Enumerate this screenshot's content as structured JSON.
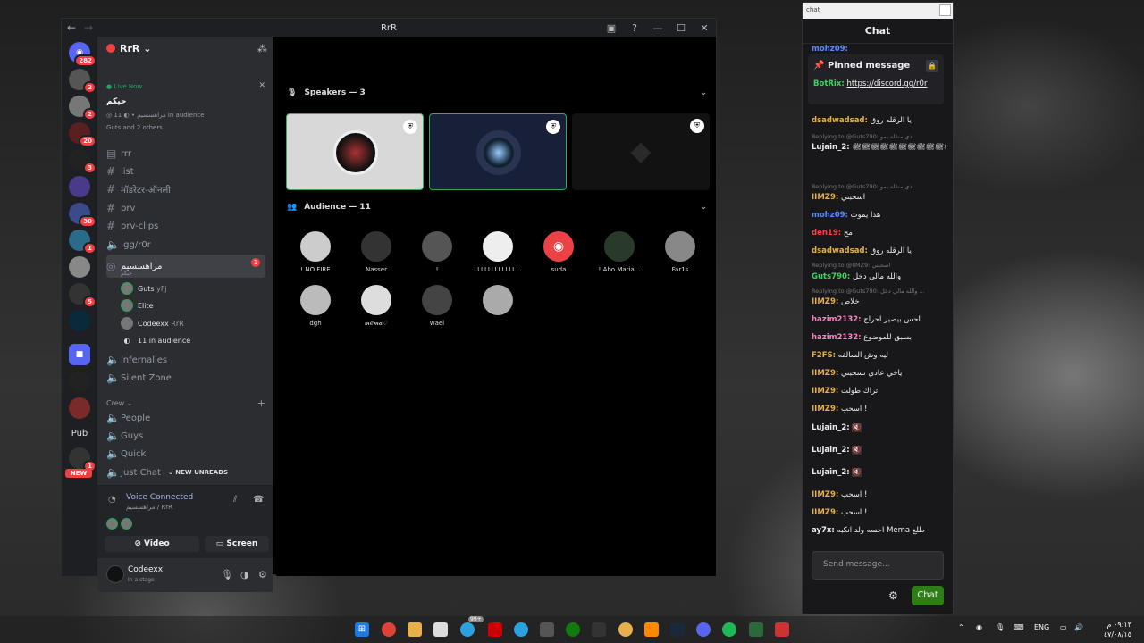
{
  "window": {
    "title": "RrR"
  },
  "server": {
    "name": "RrR",
    "live_now": "Live Now",
    "stage_topic": "حيكم",
    "stage_channel": "مراهسسيم",
    "audience_count": "11 in audience",
    "people": "Guts and 2 others"
  },
  "guild_badges": {
    "g1": "282",
    "g2": "2",
    "g3": "2",
    "g4": "20",
    "g5": "3",
    "g6": "30",
    "g7": "1",
    "g8": "5",
    "g9": "1"
  },
  "guild_labels": {
    "pub": "Pub",
    "new": "NEW"
  },
  "channels": [
    {
      "name": "rrr"
    },
    {
      "name": "list"
    },
    {
      "name": "मॉडरेटर-ऑनली"
    },
    {
      "name": "prv"
    },
    {
      "name": "prv-clips"
    },
    {
      "name": ".gg/r0r"
    }
  ],
  "stage_channel": {
    "name": "مراهسسيم",
    "topic": "حيكم",
    "badge": "1"
  },
  "stage_members": [
    {
      "name": "Guts",
      "tag": "yFj"
    },
    {
      "name": "Elite",
      "tag": ""
    },
    {
      "name": "Codeexx",
      "tag": "RrR"
    }
  ],
  "stage_audience": "11 in audience",
  "voice_channels": [
    {
      "name": "infernalles"
    },
    {
      "name": "Silent Zone"
    }
  ],
  "category": {
    "name": "Crew"
  },
  "crew_channels": [
    {
      "name": "People"
    },
    {
      "name": "Guys"
    },
    {
      "name": "Quick"
    },
    {
      "name": "Just Chat"
    }
  ],
  "new_unreads": "NEW UNREADS",
  "voice": {
    "status": "Voice Connected",
    "location": "مراهسسيم / RrR",
    "video": "Video",
    "screen": "Screen"
  },
  "user": {
    "name": "Codeexx",
    "status": "In a stage"
  },
  "speakers": {
    "heading": "Speakers — 3"
  },
  "audience": {
    "heading": "Audience — 11",
    "members": [
      {
        "name": "! NO FIRE"
      },
      {
        "name": "Nasser"
      },
      {
        "name": "!"
      },
      {
        "name": "LLLLLLLLLLLL..."
      },
      {
        "name": "suda"
      },
      {
        "name": "! Abo Maria..."
      },
      {
        "name": "Far1s"
      },
      {
        "name": "dgh"
      },
      {
        "name": "𝓂ℯ𝓂𝒶♡"
      },
      {
        "name": "wael"
      },
      {
        "name": ""
      }
    ]
  },
  "chat": {
    "window_label": "chat",
    "title": "Chat",
    "pinned_title": "Pinned message",
    "pinned_user": "BotRix:",
    "pinned_link": "https://discord.gg/r0r",
    "top_user": "mohz09:",
    "messages": [
      {
        "user": "dsadwadsad:",
        "color": "#e8b04a",
        "text": "يا الرقله روق"
      },
      {
        "reply": "Replying to @Guts790: ذي منقله يمو"
      },
      {
        "user": "Lujain_2:",
        "color": "#efeff1",
        "text": "ﷺﷺﷺﷺﷺﷺﷺﷺﷺﷺﷺﷺﷺ"
      },
      {
        "reply": "Replying to @Guts790: ذي منقله يمو"
      },
      {
        "user": "IIMZ9:",
        "color": "#e8b04a",
        "text": "اسحبني"
      },
      {
        "user": "mohz09:",
        "color": "#5b8cff",
        "text": "هذا يموت"
      },
      {
        "user": "den19:",
        "color": "#ff4040",
        "text": "مح"
      },
      {
        "user": "dsadwadsad:",
        "color": "#e8b04a",
        "text": "يا الرقله روق"
      },
      {
        "reply": "Replying to @IIMZ9: اسحبني"
      },
      {
        "user": "Guts790:",
        "color": "#3bd45f",
        "text": "والله مالي دخل"
      },
      {
        "reply": "Replying to @Guts790: والله مالي دخل ..."
      },
      {
        "user": "IIMZ9:",
        "color": "#e8b04a",
        "text": "خلاص"
      },
      {
        "user": "hazim2132:",
        "color": "#ff7fc0",
        "text": "احس بيصير احراج"
      },
      {
        "user": "hazim2132:",
        "color": "#ff7fc0",
        "text": "بسبق للموضوع"
      },
      {
        "user": "F2FS:",
        "color": "#e8b04a",
        "text": "ليه وش السالفه"
      },
      {
        "user": "IIMZ9:",
        "color": "#e8b04a",
        "text": "ياخي عادي تسحبني"
      },
      {
        "user": "IIMZ9:",
        "color": "#e8b04a",
        "text": "تراك طولت"
      },
      {
        "user": "IIMZ9:",
        "color": "#e8b04a",
        "text": "اسحب !"
      },
      {
        "user": "Lujain_2:",
        "color": "#efeff1",
        "text": ""
      },
      {
        "user": "Lujain_2:",
        "color": "#efeff1",
        "text": ""
      },
      {
        "user": "Lujain_2:",
        "color": "#efeff1",
        "text": ""
      },
      {
        "user": "IIMZ9:",
        "color": "#e8b04a",
        "text": "اسحب !"
      },
      {
        "user": "IIMZ9:",
        "color": "#e8b04a",
        "text": "اسحب !"
      },
      {
        "user": "ay7x:",
        "color": "#efeff1",
        "text": "احسه ولد انكبه Mema طلع"
      }
    ],
    "input_placeholder": "Send message...",
    "send_label": "Chat"
  },
  "taskbar": {
    "lang": "ENG",
    "time": "٠٩:١٣ م",
    "date": "٤٧/٠٨/١٥",
    "chrome_badge": "99+"
  }
}
